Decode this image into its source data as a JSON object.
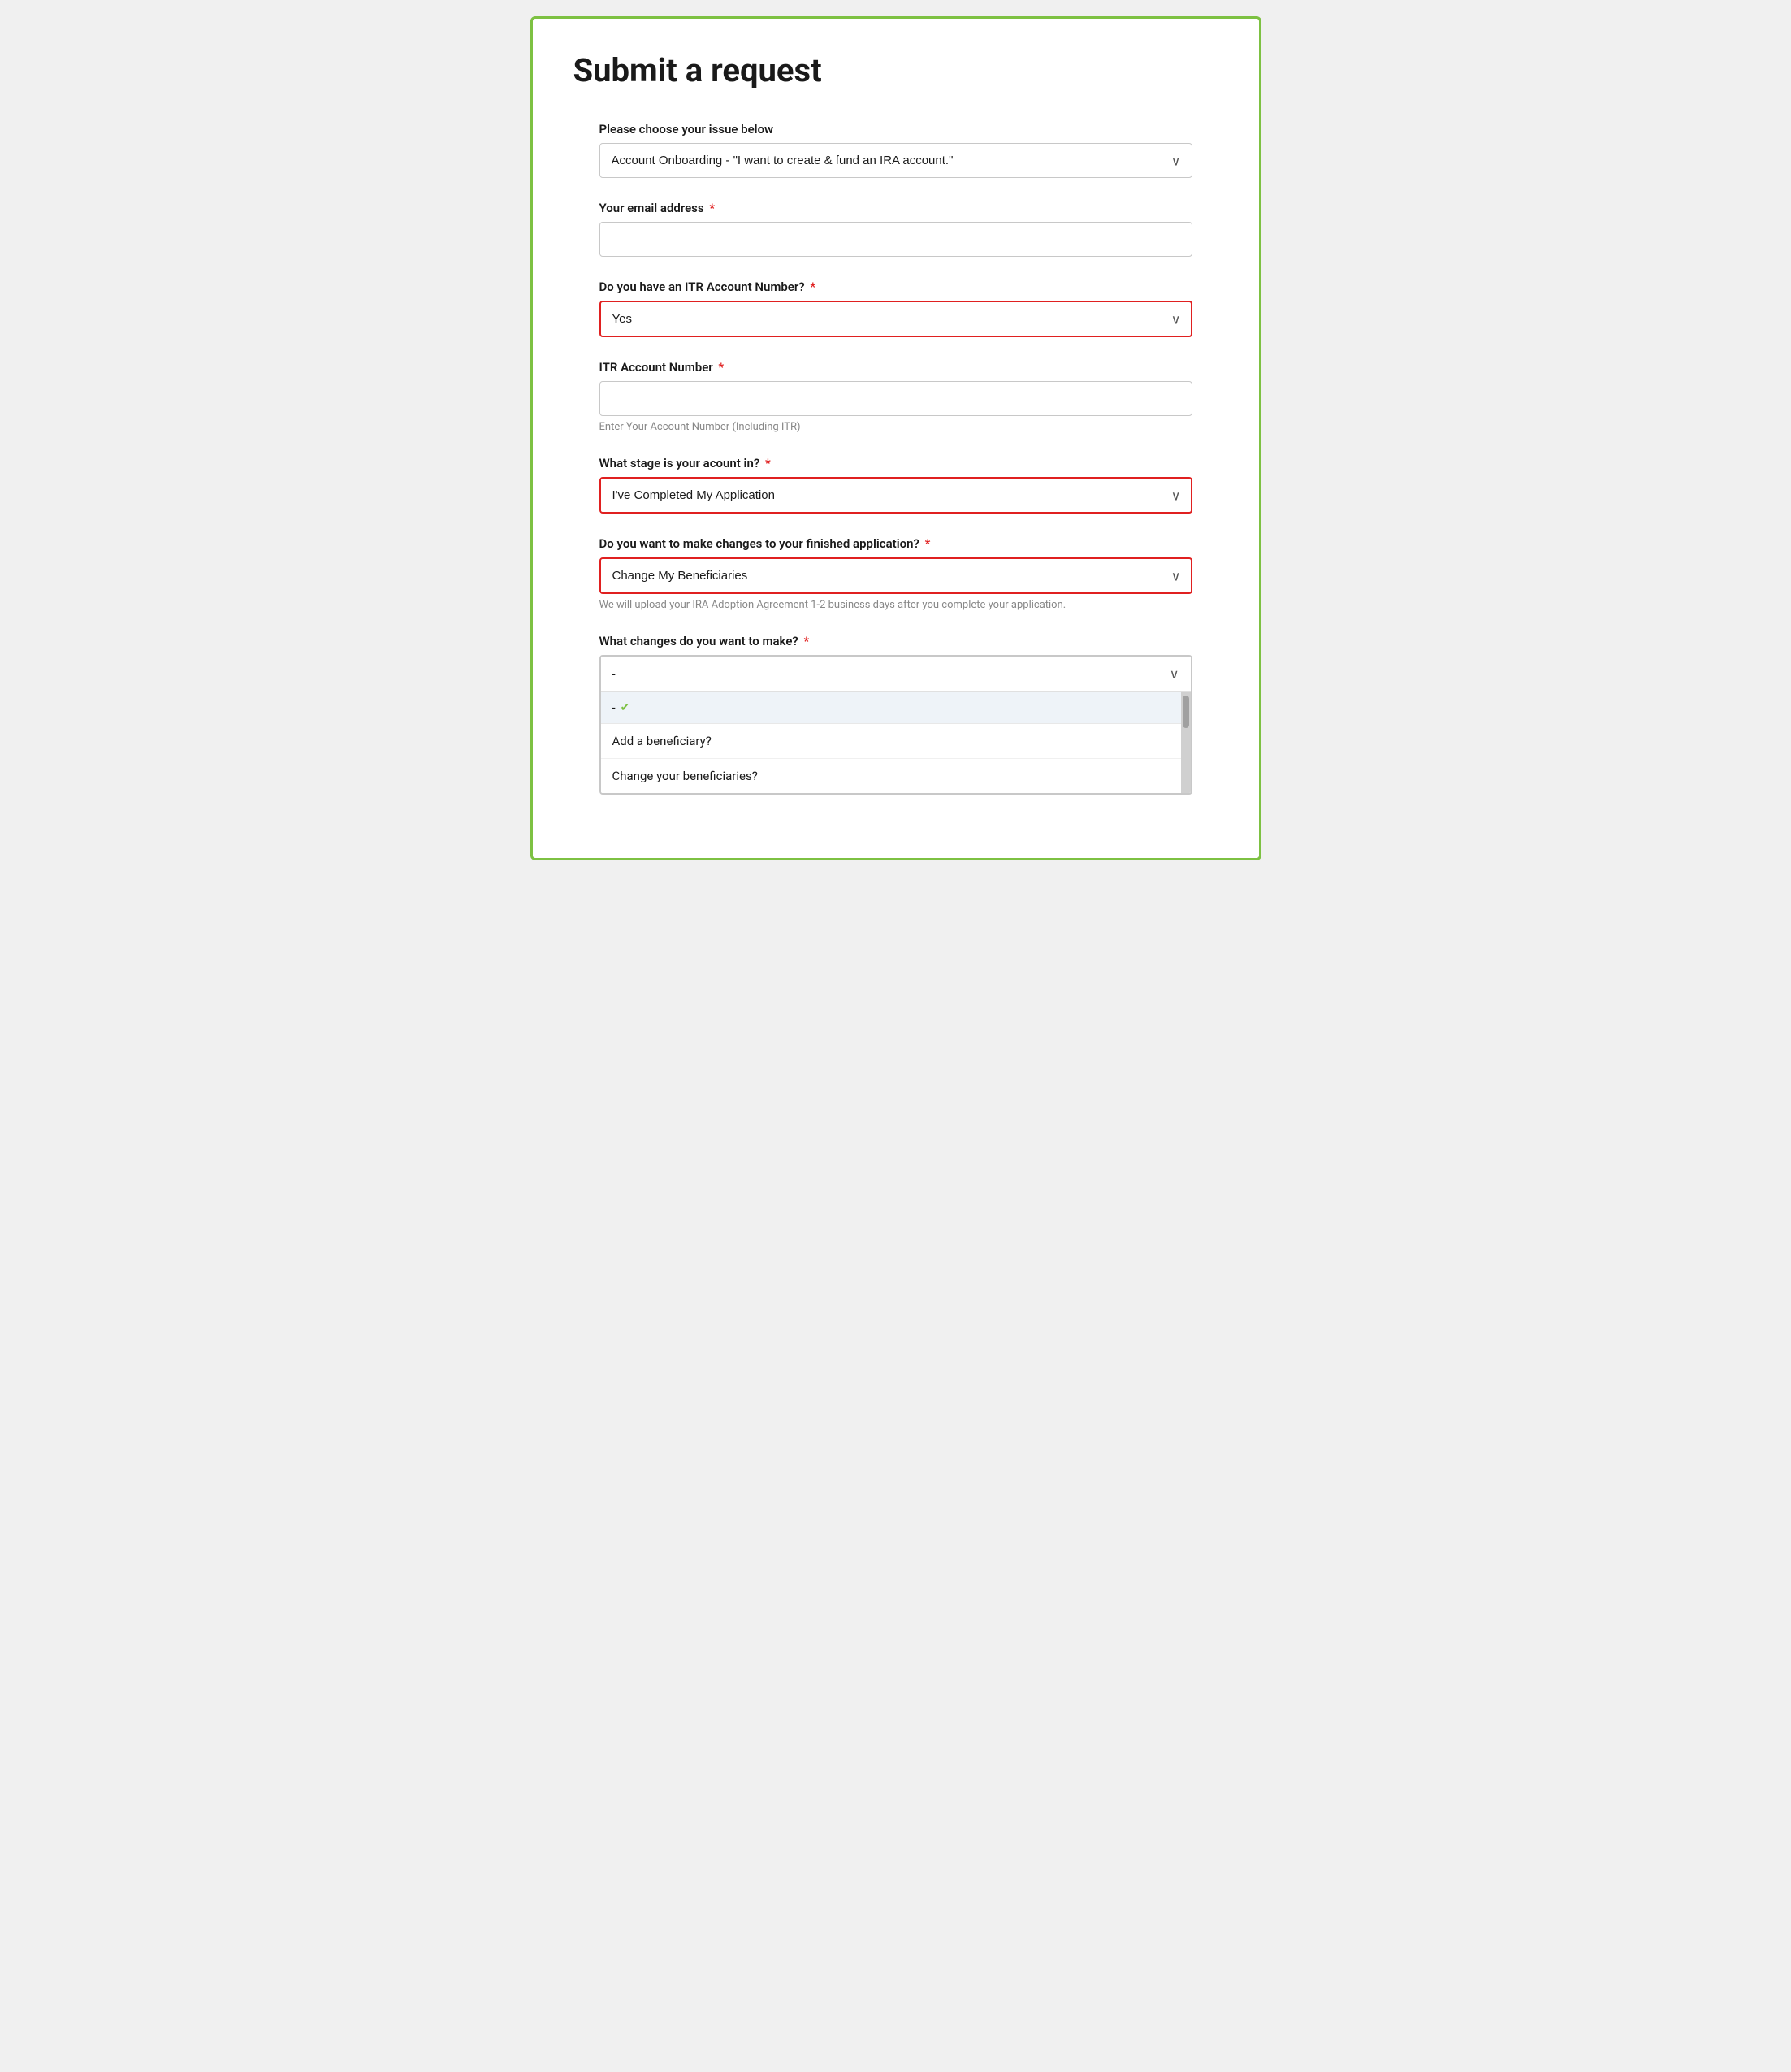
{
  "page": {
    "title": "Submit a request"
  },
  "form": {
    "issue_label": "Please choose your issue below",
    "issue_value": "Account Onboarding - \"I want to create & fund an IRA account.\"",
    "email_label": "Your email address",
    "email_required": true,
    "itr_account_label": "Do you have an ITR Account Number?",
    "itr_account_required": true,
    "itr_account_value": "Yes",
    "account_number_label": "ITR Account Number",
    "account_number_required": true,
    "account_number_placeholder": "Enter Your Account Number (Including ITR)",
    "stage_label": "What stage is your acount in?",
    "stage_required": true,
    "stage_value": "I've Completed My Application",
    "changes_label": "Do you want to make changes to your finished application?",
    "changes_required": true,
    "changes_value": "Change My Beneficiaries",
    "upload_note": "We will upload your IRA Adoption Agreement 1-2 business days after you complete your application.",
    "what_changes_label": "What changes do you want to make?",
    "what_changes_required": true,
    "what_changes_placeholder": "-",
    "dropdown_selected": "-",
    "dropdown_checkmark": "✔",
    "dropdown_items": [
      "Add a beneficiary?",
      "Change your beneficiaries?"
    ]
  }
}
